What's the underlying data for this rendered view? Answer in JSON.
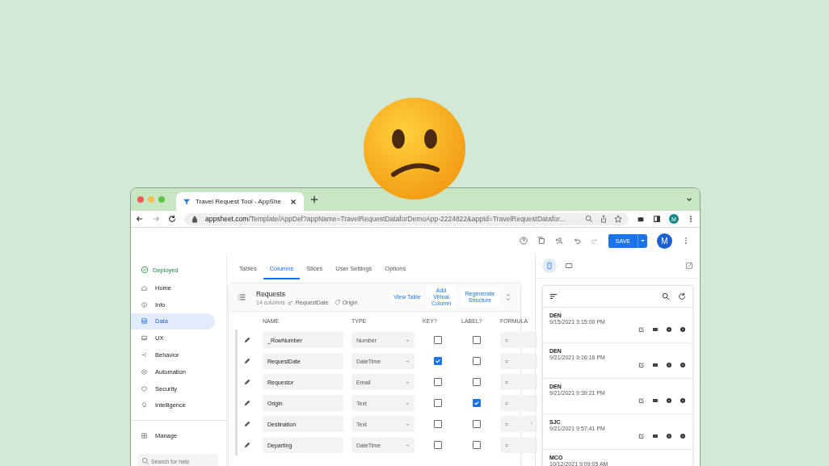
{
  "browser": {
    "tab_title": "Travel Request Tool - AppShe",
    "url_host": "appsheet.com",
    "url_path": "/Template/AppDef?appName=TravelRequestDataforDemoApp-2224822&appId=TravelRequestDatafor...",
    "profile_initial": "M"
  },
  "header": {
    "save_label": "SAVE",
    "avatar_initial": "M"
  },
  "sidebar": {
    "status": "Deployed",
    "items": [
      {
        "label": "Home",
        "selected": false
      },
      {
        "label": "Info",
        "selected": false
      },
      {
        "label": "Data",
        "selected": true
      },
      {
        "label": "UX",
        "selected": false
      },
      {
        "label": "Behavior",
        "selected": false
      },
      {
        "label": "Automation",
        "selected": false
      },
      {
        "label": "Security",
        "selected": false
      },
      {
        "label": "Intelligence",
        "selected": false
      }
    ],
    "manage": "Manage",
    "search": {
      "placeholder": "Search for help"
    }
  },
  "tabs": [
    {
      "label": "Tables",
      "selected": false
    },
    {
      "label": "Columns",
      "selected": true
    },
    {
      "label": "Slices",
      "selected": false
    },
    {
      "label": "User Settings",
      "selected": false
    },
    {
      "label": "Options",
      "selected": false
    }
  ],
  "table_card": {
    "title": "Requests",
    "count": "14 columns",
    "key_tag": "RequestDate",
    "label_tag": "Origin",
    "actions": [
      "View Table",
      "Add Virtual Column",
      "Regenerate Structure"
    ],
    "columns": [
      "NAME",
      "TYPE",
      "KEY?",
      "LABEL?",
      "FORMULA"
    ],
    "rows": [
      {
        "name": "_RowNumber",
        "type": "Number",
        "key": false,
        "label": false,
        "formula": "="
      },
      {
        "name": "RequestDate",
        "type": "DateTime",
        "key": true,
        "label": false,
        "formula": "="
      },
      {
        "name": "Requestor",
        "type": "Email",
        "key": false,
        "label": false,
        "formula": "="
      },
      {
        "name": "Origin",
        "type": "Text",
        "key": false,
        "label": true,
        "formula": "="
      },
      {
        "name": "Destination",
        "type": "Text",
        "key": false,
        "label": false,
        "formula": "="
      },
      {
        "name": "Departing",
        "type": "DateTime",
        "key": false,
        "label": false,
        "formula": "="
      }
    ]
  },
  "preview": {
    "views": [
      {
        "kind": "phone",
        "selected": true
      },
      {
        "kind": "tablet",
        "selected": false
      }
    ],
    "records": [
      {
        "title": "DEN",
        "date": "9/15/2021 3:15:00 PM"
      },
      {
        "title": "DEN",
        "date": "9/21/2021 9:16:16 PM"
      },
      {
        "title": "DEN",
        "date": "9/21/2021 9:39:21 PM"
      },
      {
        "title": "SJC",
        "date": "9/21/2021 9:57:41 PM"
      },
      {
        "title": "MCO",
        "date": "10/12/2021 9:09:05 AM"
      }
    ]
  }
}
